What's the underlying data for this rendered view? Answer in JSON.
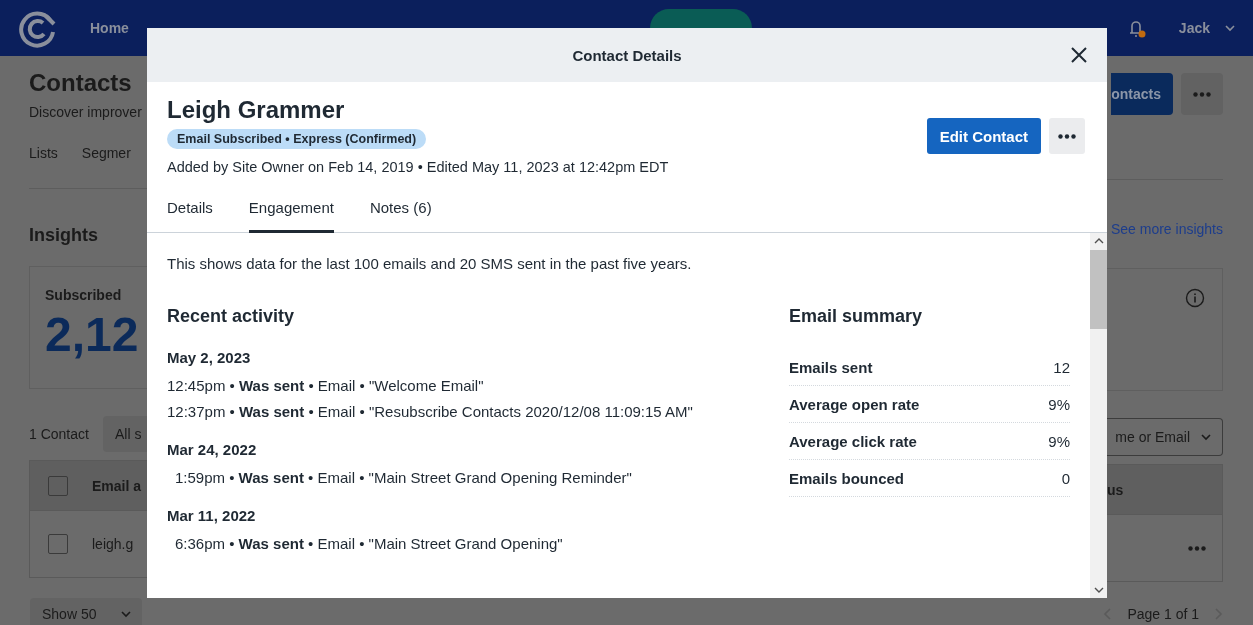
{
  "nav": {
    "items": [
      {
        "label": "Home"
      }
    ],
    "notifications": {
      "unread": true
    },
    "user": "Jack"
  },
  "page": {
    "title": "Contacts",
    "subtitle": "Discover improver",
    "tabs": [
      "Lists",
      "Segmer"
    ],
    "primary_button": "ontacts",
    "insights": "Insights",
    "see_more": "See more insights",
    "card": {
      "label": "Subscribed",
      "value": "2,12"
    },
    "contact_count": "1 Contact",
    "filter": "All s",
    "search_by": "me or Email",
    "table": {
      "header_checkbox": {
        "checked": false
      },
      "columns": [
        "Email a",
        "us"
      ],
      "rows": [
        {
          "checked": false,
          "column_1": "leigh.g"
        }
      ]
    },
    "page_size": "Show 50",
    "pagination": "Page 1 of 1"
  },
  "modal": {
    "title": "Contact Details",
    "name": "Leigh Grammer",
    "badge": "Email Subscribed • Express (Confirmed)",
    "meta": "Added by Site Owner on Feb 14, 2019 • Edited May 11, 2023 at 12:42pm EDT",
    "primary_button": "Edit Contact",
    "tabs": [
      {
        "label": "Details",
        "selected": false
      },
      {
        "label": "Engagement",
        "selected": true
      },
      {
        "label": "Notes (6)",
        "selected": false
      }
    ],
    "intro": "This shows data for the last 100 emails and 20 SMS sent in the past five years.",
    "activity": {
      "title": "Recent activity",
      "days": [
        {
          "date": "May 2, 2023",
          "events": [
            {
              "time": "12:45pm",
              "detail": " • **Was sent** • Email • \"Welcome Email\""
            },
            {
              "time": "12:37pm",
              "detail": " • **Was sent** • Email • \"Resubscribe Contacts 2020/12/08 11:09:15 AM\""
            }
          ]
        },
        {
          "date": "Mar 24, 2022",
          "events": [
            {
              "time": "1:59pm",
              "detail": " • **Was sent** • Email • \"Main Street Grand Opening Reminder\""
            }
          ]
        },
        {
          "date": "Mar 11, 2022",
          "events": [
            {
              "time": "6:36pm",
              "detail": " • **Was sent** • Email • \"Main Street Grand Opening\""
            }
          ]
        }
      ]
    },
    "summary": {
      "title": "Email summary",
      "rows": [
        {
          "label": "Emails sent",
          "value": "12"
        },
        {
          "label": "Average open rate",
          "value": "9%"
        },
        {
          "label": "Average click rate",
          "value": "9%"
        },
        {
          "label": "Emails bounced",
          "value": "0"
        }
      ]
    }
  }
}
